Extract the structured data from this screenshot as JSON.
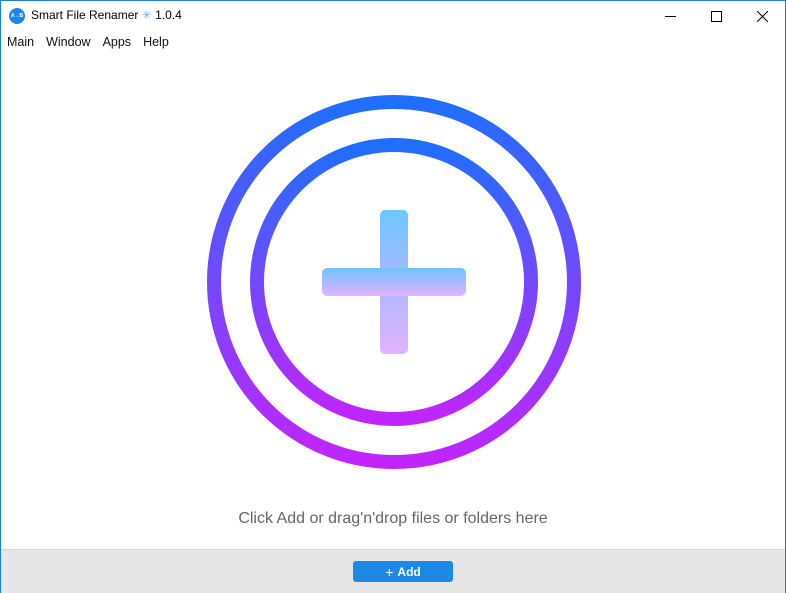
{
  "window": {
    "title": "Smart File Renamer",
    "title_separator": "✳",
    "version": "1.0.4",
    "app_icon_text": "A→B",
    "controls": {
      "minimize_icon": "minimize-icon",
      "maximize_icon": "maximize-icon",
      "close_icon": "close-icon"
    }
  },
  "menubar": {
    "items": [
      {
        "label": "Main"
      },
      {
        "label": "Window"
      },
      {
        "label": "Apps"
      },
      {
        "label": "Help"
      }
    ]
  },
  "dropzone": {
    "icon": "add-circle-icon",
    "hint": "Click Add or drag'n'drop files or folders here",
    "colors": {
      "ring_top": "#1e6fff",
      "ring_bottom": "#c125ff",
      "plus_top": "#6ec6ff",
      "plus_bottom": "#e2b3ff"
    }
  },
  "footer": {
    "add_button": {
      "icon": "+",
      "label": "Add"
    }
  },
  "colors": {
    "accent": "#1e88e5",
    "footer_bg": "#e6e6e6",
    "hint_text": "#666666"
  }
}
